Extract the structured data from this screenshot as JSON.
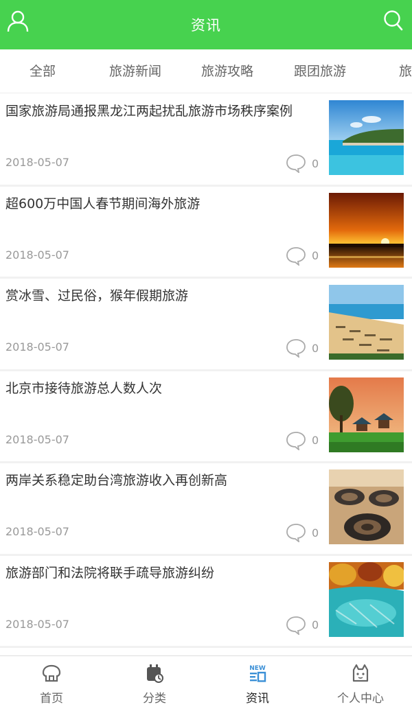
{
  "header": {
    "title": "资讯",
    "left_icon": "user-icon",
    "right_icon": "search-icon",
    "color": "#47d24f"
  },
  "tabs": [
    {
      "label": "全部"
    },
    {
      "label": "旅游新闻"
    },
    {
      "label": "旅游攻略"
    },
    {
      "label": "跟团旅游"
    },
    {
      "label": "旅游"
    }
  ],
  "news": [
    {
      "title": "国家旅游局通报黑龙江两起扰乱旅游市场秩序案例",
      "date": "2018-05-07",
      "comments": "0",
      "thumb": "coast-island-photo"
    },
    {
      "title": "超600万中国人春节期间海外旅游",
      "date": "2018-05-07",
      "comments": "0",
      "thumb": "sunset-photo"
    },
    {
      "title": "赏冰雪、过民俗，猴年假期旅游",
      "date": "2018-05-07",
      "comments": "0",
      "thumb": "beach-umbrellas-photo"
    },
    {
      "title": "北京市接待旅游总人数人次",
      "date": "2018-05-07",
      "comments": "0",
      "thumb": "pavilion-garden-photo"
    },
    {
      "title": "两岸关系稳定助台湾旅游收入再创新高",
      "date": "2018-05-07",
      "comments": "0",
      "thumb": "tulou-aerial-photo"
    },
    {
      "title": "旅游部门和法院将联手疏导旅游纠纷",
      "date": "2018-05-07",
      "comments": "0",
      "thumb": "autumn-lake-photo"
    }
  ],
  "bottom_nav": [
    {
      "label": "首页",
      "icon": "home-icon"
    },
    {
      "label": "分类",
      "icon": "category-icon"
    },
    {
      "label": "资讯",
      "icon": "news-icon",
      "badge": "NEW",
      "active": true
    },
    {
      "label": "个人中心",
      "icon": "profile-icon"
    }
  ],
  "colors": {
    "accent": "#47d24f",
    "news_icon": "#3a8fd6"
  }
}
